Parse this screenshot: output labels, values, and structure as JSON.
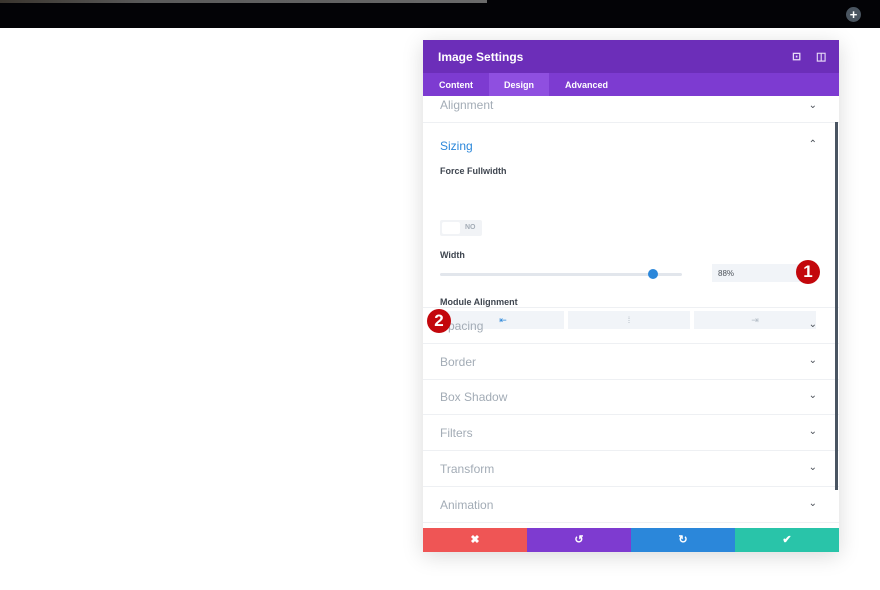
{
  "topbar": {
    "add_icon": "plus-icon"
  },
  "panel": {
    "title": "Image Settings",
    "tabs": [
      {
        "label": "Content"
      },
      {
        "label": "Design"
      },
      {
        "label": "Advanced"
      }
    ],
    "active_tab": "Design"
  },
  "sections": {
    "alignment": "Alignment",
    "sizing": {
      "title": "Sizing",
      "force_fullwidth_label": "Force Fullwidth",
      "force_fullwidth_value": "NO",
      "width_label": "Width",
      "width_value": "88%",
      "width_percent": 88,
      "module_alignment_label": "Module Alignment",
      "alignment_options": [
        "left",
        "center",
        "right"
      ],
      "selected_alignment": "left"
    },
    "collapsed": [
      "Spacing",
      "Border",
      "Box Shadow",
      "Filters",
      "Transform",
      "Animation"
    ]
  },
  "annotations": [
    "1",
    "2"
  ],
  "footer": {
    "colors": {
      "cancel": "#ef5555",
      "undo": "#7e3bd0",
      "redo": "#2b87da",
      "save": "#29c4a9"
    }
  }
}
